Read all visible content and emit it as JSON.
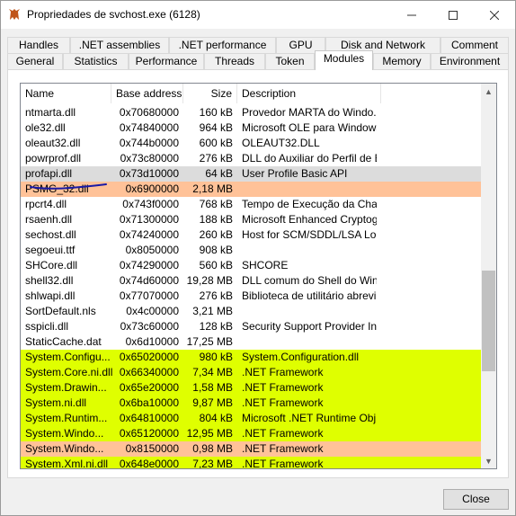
{
  "window": {
    "title": "Propriedades de svchost.exe (6128)"
  },
  "tabs_top": [
    {
      "label": "Handles"
    },
    {
      "label": ".NET assemblies"
    },
    {
      "label": ".NET performance"
    },
    {
      "label": "GPU"
    },
    {
      "label": "Disk and Network"
    },
    {
      "label": "Comment"
    }
  ],
  "tabs_bottom": [
    {
      "label": "General"
    },
    {
      "label": "Statistics"
    },
    {
      "label": "Performance"
    },
    {
      "label": "Threads"
    },
    {
      "label": "Token"
    },
    {
      "label": "Modules"
    },
    {
      "label": "Memory"
    },
    {
      "label": "Environment"
    }
  ],
  "active_tab": "Modules",
  "columns": {
    "name": "Name",
    "base": "Base address",
    "size": "Size",
    "desc": "Description"
  },
  "rows": [
    {
      "name": "ntmarta.dll",
      "base": "0x70680000",
      "size": "160 kB",
      "desc": "Provedor MARTA do Windo...",
      "hl": ""
    },
    {
      "name": "ole32.dll",
      "base": "0x74840000",
      "size": "964 kB",
      "desc": "Microsoft OLE para Windows",
      "hl": ""
    },
    {
      "name": "oleaut32.dll",
      "base": "0x744b0000",
      "size": "600 kB",
      "desc": "OLEAUT32.DLL",
      "hl": ""
    },
    {
      "name": "powrprof.dll",
      "base": "0x73c80000",
      "size": "276 kB",
      "desc": "DLL do Auxiliar do Perfil de E...",
      "hl": ""
    },
    {
      "name": "profapi.dll",
      "base": "0x73d10000",
      "size": "64 kB",
      "desc": "User Profile Basic API",
      "hl": "gray"
    },
    {
      "name": "PSMG_32.dll",
      "base": "0x6900000",
      "size": "2,18 MB",
      "desc": "",
      "hl": "orange"
    },
    {
      "name": "rpcrt4.dll",
      "base": "0x743f0000",
      "size": "768 kB",
      "desc": "Tempo de Execução da Cha...",
      "hl": ""
    },
    {
      "name": "rsaenh.dll",
      "base": "0x71300000",
      "size": "188 kB",
      "desc": "Microsoft Enhanced Cryptog...",
      "hl": ""
    },
    {
      "name": "sechost.dll",
      "base": "0x74240000",
      "size": "260 kB",
      "desc": "Host for SCM/SDDL/LSA Loo...",
      "hl": ""
    },
    {
      "name": "segoeui.ttf",
      "base": "0x8050000",
      "size": "908 kB",
      "desc": "",
      "hl": ""
    },
    {
      "name": "SHCore.dll",
      "base": "0x74290000",
      "size": "560 kB",
      "desc": "SHCORE",
      "hl": ""
    },
    {
      "name": "shell32.dll",
      "base": "0x74d60000",
      "size": "19,28 MB",
      "desc": "DLL comum do Shell do Wind...",
      "hl": ""
    },
    {
      "name": "shlwapi.dll",
      "base": "0x77070000",
      "size": "276 kB",
      "desc": "Biblioteca de utilitário abrevi...",
      "hl": ""
    },
    {
      "name": "SortDefault.nls",
      "base": "0x4c00000",
      "size": "3,21 MB",
      "desc": "",
      "hl": ""
    },
    {
      "name": "sspicli.dll",
      "base": "0x73c60000",
      "size": "128 kB",
      "desc": "Security Support Provider In...",
      "hl": ""
    },
    {
      "name": "StaticCache.dat",
      "base": "0x6d10000",
      "size": "17,25 MB",
      "desc": "",
      "hl": ""
    },
    {
      "name": "System.Configu...",
      "base": "0x65020000",
      "size": "980 kB",
      "desc": "System.Configuration.dll",
      "hl": "yellow"
    },
    {
      "name": "System.Core.ni.dll",
      "base": "0x66340000",
      "size": "7,34 MB",
      "desc": ".NET Framework",
      "hl": "yellow"
    },
    {
      "name": "System.Drawin...",
      "base": "0x65e20000",
      "size": "1,58 MB",
      "desc": ".NET Framework",
      "hl": "yellow"
    },
    {
      "name": "System.ni.dll",
      "base": "0x6ba10000",
      "size": "9,87 MB",
      "desc": ".NET Framework",
      "hl": "yellow"
    },
    {
      "name": "System.Runtim...",
      "base": "0x64810000",
      "size": "804 kB",
      "desc": "Microsoft .NET Runtime Obj...",
      "hl": "yellow"
    },
    {
      "name": "System.Windo...",
      "base": "0x65120000",
      "size": "12,95 MB",
      "desc": ".NET Framework",
      "hl": "yellow"
    },
    {
      "name": "System.Windo...",
      "base": "0x8150000",
      "size": "0,98 MB",
      "desc": ".NET Framework",
      "hl": "orange"
    },
    {
      "name": "System.Xml.ni.dll",
      "base": "0x648e0000",
      "size": "7,23 MB",
      "desc": ".NET Framework",
      "hl": "yellow"
    }
  ],
  "buttons": {
    "close": "Close"
  },
  "colors": {
    "gray_row": "#dcdcdc",
    "orange_row": "#ffc298",
    "yellow_row": "#dfff00",
    "annotation": "#1a1aa6"
  },
  "icons": {
    "app": "process-hacker-icon",
    "minimize": "minimize-icon",
    "maximize": "maximize-icon",
    "close": "close-icon"
  }
}
